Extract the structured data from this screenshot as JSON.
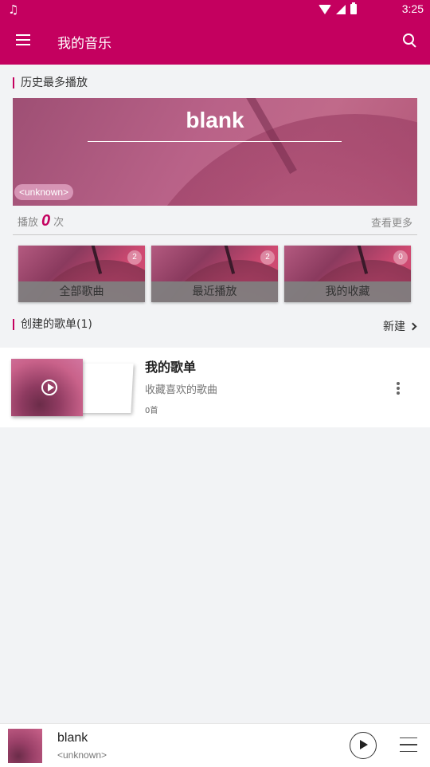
{
  "status_bar": {
    "time": "3:25",
    "notification_icon": "music-note-icon"
  },
  "app_bar": {
    "title": "我的音乐",
    "menu_icon": "menu-icon",
    "search_icon": "search-icon"
  },
  "history": {
    "section_title": "历史最多播放",
    "song_title": "blank",
    "artist": "<unknown>",
    "play_prefix": "播放",
    "play_count": "0",
    "play_suffix": "次",
    "see_more": "查看更多"
  },
  "tiles": [
    {
      "label": "全部歌曲",
      "count": "2"
    },
    {
      "label": "最近播放",
      "count": "2"
    },
    {
      "label": "我的收藏",
      "count": "0"
    }
  ],
  "created_playlists": {
    "section_title": "创建的歌单(1)",
    "new_label": "新建",
    "items": [
      {
        "name": "我的歌单",
        "description": "收藏喜欢的歌曲",
        "count": "0首"
      }
    ]
  },
  "player": {
    "song": "blank",
    "artist": "<unknown>"
  },
  "colors": {
    "accent": "#c4005f",
    "background": "#f2f3f5"
  }
}
